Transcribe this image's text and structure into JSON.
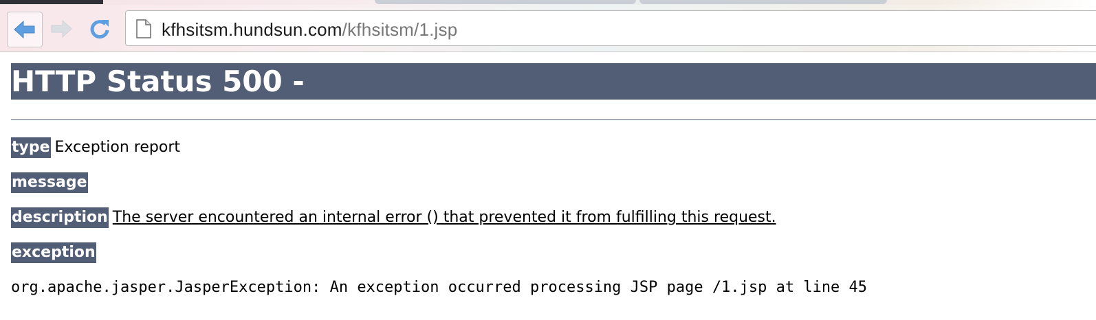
{
  "browser": {
    "url_host": "kfhsitsm.hundsun.com",
    "url_path": "/kfhsitsm/1.jsp",
    "icons": [
      "back-arrow-icon",
      "forward-arrow-icon",
      "reload-icon",
      "page-icon"
    ]
  },
  "page": {
    "heading": "HTTP Status 500 -",
    "type_label": "type",
    "type_value": "Exception report",
    "message_label": "message",
    "message_value": "",
    "description_label": "description",
    "description_value": "The server encountered an internal error () that prevented it from fulfilling this request.",
    "exception_label": "exception",
    "exception_value": "org.apache.jasper.JasperException: An exception occurred processing JSP page /1.jsp at line 45"
  },
  "colors": {
    "tomcat_bar": "#525d76",
    "back_arrow": "#5d9fe0"
  }
}
